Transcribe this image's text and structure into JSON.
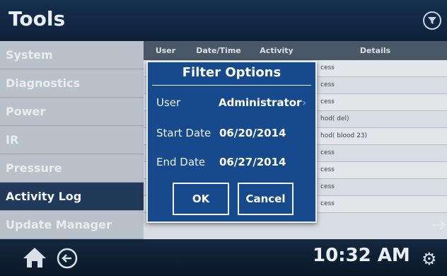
{
  "header": {
    "title": "Tools"
  },
  "sidebar": {
    "items": [
      "System",
      "Diagnostics",
      "Power",
      "IR",
      "Pressure",
      "Activity Log",
      "Update Manager"
    ],
    "active_index": 5
  },
  "table": {
    "columns": [
      "User",
      "Date/Time",
      "Activity",
      "Details"
    ],
    "visible_details": [
      "cess",
      "cess",
      "cess",
      "hod( del)",
      "hod( blood 23)",
      "cess",
      "cess",
      "cess",
      "cess"
    ]
  },
  "modal": {
    "title": "Filter Options",
    "user_label": "User",
    "user_value": "Administrator",
    "start_label": "Start Date",
    "start_value": "06/20/2014",
    "end_label": "End Date",
    "end_value": "06/27/2014",
    "ok": "OK",
    "cancel": "Cancel"
  },
  "footer": {
    "time": "10:32 AM"
  },
  "icons": {
    "filter": "filter-icon",
    "home": "home-icon",
    "back": "back-icon",
    "settings": "gear-icon",
    "next": "arrow-right-icon"
  }
}
